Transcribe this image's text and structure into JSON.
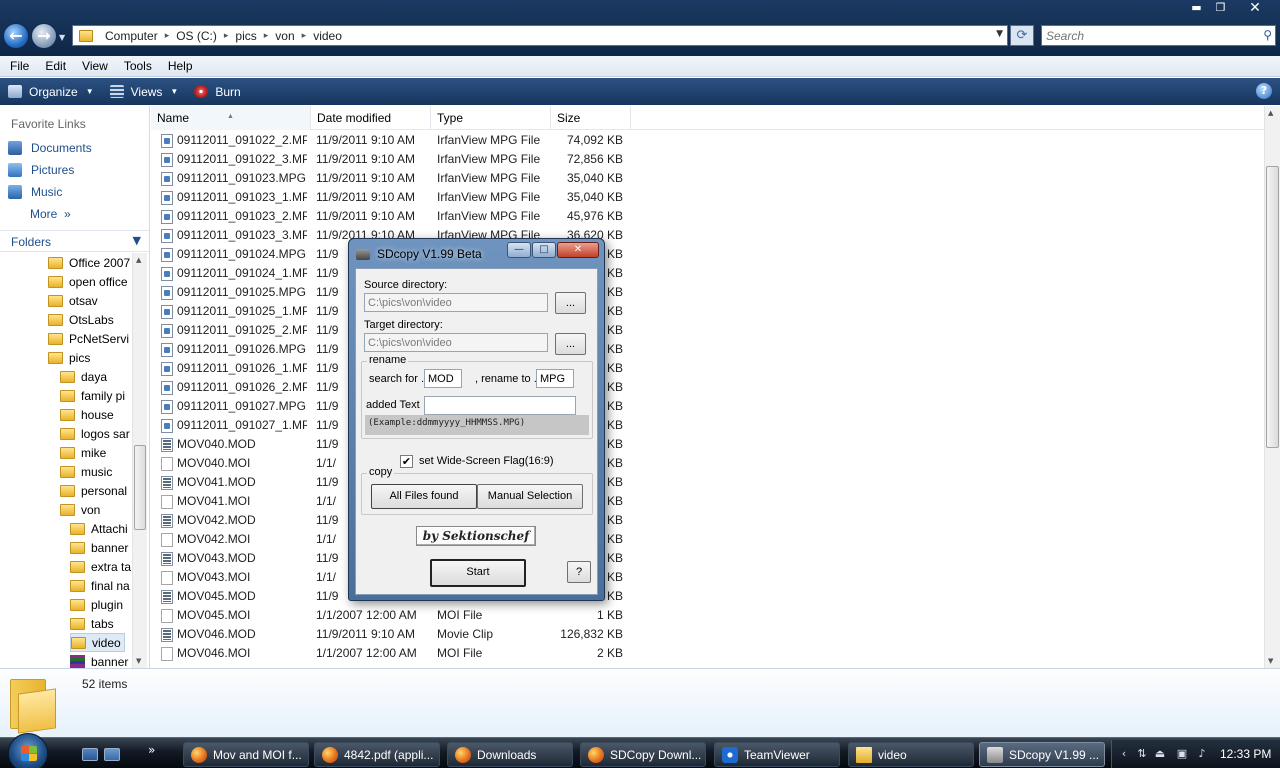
{
  "explorer": {
    "breadcrumbs": [
      "Computer",
      "OS (C:)",
      "pics",
      "von",
      "video"
    ],
    "search_placeholder": "Search",
    "window_controls": {
      "minimize": "▬",
      "maximize": "❐",
      "close": "✕"
    },
    "menu": [
      "File",
      "Edit",
      "View",
      "Tools",
      "Help"
    ],
    "toolbar": {
      "organize": "Organize",
      "views": "Views",
      "burn": "Burn",
      "help": "?"
    },
    "favorites": {
      "header": "Favorite Links",
      "items": [
        "Documents",
        "Pictures",
        "Music"
      ],
      "more": "More",
      "more_glyph": "»"
    },
    "folders": {
      "header": "Folders",
      "tree": [
        {
          "label": "Office 2007",
          "level": 1
        },
        {
          "label": "open office",
          "level": 1
        },
        {
          "label": "otsav",
          "level": 1
        },
        {
          "label": "OtsLabs",
          "level": 1
        },
        {
          "label": "PcNetServi",
          "level": 1
        },
        {
          "label": "pics",
          "level": 1
        },
        {
          "label": "daya",
          "level": 2
        },
        {
          "label": "family pi",
          "level": 2
        },
        {
          "label": "house",
          "level": 2
        },
        {
          "label": "logos sar",
          "level": 2
        },
        {
          "label": "mike",
          "level": 2
        },
        {
          "label": "music",
          "level": 2
        },
        {
          "label": "personal",
          "level": 2
        },
        {
          "label": "von",
          "level": 2
        },
        {
          "label": "Attachi",
          "level": 3
        },
        {
          "label": "banner",
          "level": 3
        },
        {
          "label": "extra ta",
          "level": 3
        },
        {
          "label": "final na",
          "level": 3
        },
        {
          "label": "plugin",
          "level": 3
        },
        {
          "label": "tabs",
          "level": 3
        },
        {
          "label": "video",
          "level": 3,
          "selected": true
        },
        {
          "label": "banner",
          "level": 3,
          "archive": true
        }
      ]
    },
    "columns": {
      "name": "Name",
      "date": "Date modified",
      "type": "Type",
      "size": "Size"
    },
    "files": [
      {
        "name": "09112011_091022_2.MPG",
        "date": "11/9/2011 9:10 AM",
        "type": "IrfanView MPG File",
        "size": "74,092 KB",
        "icon": "mpg"
      },
      {
        "name": "09112011_091022_3.MPG",
        "date": "11/9/2011 9:10 AM",
        "type": "IrfanView MPG File",
        "size": "72,856 KB",
        "icon": "mpg"
      },
      {
        "name": "09112011_091023.MPG",
        "date": "11/9/2011 9:10 AM",
        "type": "IrfanView MPG File",
        "size": "35,040 KB",
        "icon": "mpg"
      },
      {
        "name": "09112011_091023_1.MPG",
        "date": "11/9/2011 9:10 AM",
        "type": "IrfanView MPG File",
        "size": "35,040 KB",
        "icon": "mpg"
      },
      {
        "name": "09112011_091023_2.MPG",
        "date": "11/9/2011 9:10 AM",
        "type": "IrfanView MPG File",
        "size": "45,976 KB",
        "icon": "mpg"
      },
      {
        "name": "09112011_091023_3.MPG",
        "date": "11/9/2011 9:10 AM",
        "type": "IrfanView MPG File",
        "size": "36,620 KB",
        "icon": "mpg"
      },
      {
        "name": "09112011_091024.MPG",
        "date": "11/9",
        "type": "",
        "size": "KB",
        "icon": "mpg"
      },
      {
        "name": "09112011_091024_1.MPG",
        "date": "11/9",
        "type": "",
        "size": "KB",
        "icon": "mpg"
      },
      {
        "name": "09112011_091025.MPG",
        "date": "11/9",
        "type": "",
        "size": "KB",
        "icon": "mpg"
      },
      {
        "name": "09112011_091025_1.MPG",
        "date": "11/9",
        "type": "",
        "size": "KB",
        "icon": "mpg"
      },
      {
        "name": "09112011_091025_2.MPG",
        "date": "11/9",
        "type": "",
        "size": "KB",
        "icon": "mpg"
      },
      {
        "name": "09112011_091026.MPG",
        "date": "11/9",
        "type": "",
        "size": "KB",
        "icon": "mpg"
      },
      {
        "name": "09112011_091026_1.MPG",
        "date": "11/9",
        "type": "",
        "size": "KB",
        "icon": "mpg"
      },
      {
        "name": "09112011_091026_2.MPG",
        "date": "11/9",
        "type": "",
        "size": "KB",
        "icon": "mpg"
      },
      {
        "name": "09112011_091027.MPG",
        "date": "11/9",
        "type": "",
        "size": "KB",
        "icon": "mpg"
      },
      {
        "name": "09112011_091027_1.MPG",
        "date": "11/9",
        "type": "",
        "size": "KB",
        "icon": "mpg"
      },
      {
        "name": "MOV040.MOD",
        "date": "11/9",
        "type": "",
        "size": "KB",
        "icon": "mod"
      },
      {
        "name": "MOV040.MOI",
        "date": "1/1/",
        "type": "",
        "size": "KB",
        "icon": "moi"
      },
      {
        "name": "MOV041.MOD",
        "date": "11/9",
        "type": "",
        "size": "KB",
        "icon": "mod"
      },
      {
        "name": "MOV041.MOI",
        "date": "1/1/",
        "type": "",
        "size": "KB",
        "icon": "moi"
      },
      {
        "name": "MOV042.MOD",
        "date": "11/9",
        "type": "",
        "size": "KB",
        "icon": "mod"
      },
      {
        "name": "MOV042.MOI",
        "date": "1/1/",
        "type": "",
        "size": "KB",
        "icon": "moi"
      },
      {
        "name": "MOV043.MOD",
        "date": "11/9",
        "type": "",
        "size": "KB",
        "icon": "mod"
      },
      {
        "name": "MOV043.MOI",
        "date": "1/1/",
        "type": "",
        "size": "KB",
        "icon": "moi"
      },
      {
        "name": "MOV045.MOD",
        "date": "11/9",
        "type": "",
        "size": "KB",
        "icon": "mod"
      },
      {
        "name": "MOV045.MOI",
        "date": "1/1/2007 12:00 AM",
        "type": "MOI File",
        "size": "1 KB",
        "icon": "moi"
      },
      {
        "name": "MOV046.MOD",
        "date": "11/9/2011 9:10 AM",
        "type": "Movie Clip",
        "size": "126,832 KB",
        "icon": "mod"
      },
      {
        "name": "MOV046.MOI",
        "date": "1/1/2007 12:00 AM",
        "type": "MOI File",
        "size": "2 KB",
        "icon": "moi"
      }
    ],
    "status": {
      "items_count": "52 items"
    }
  },
  "dialog": {
    "title": "SDcopy V1.99 Beta",
    "controls": {
      "minimize": "—",
      "maximize": "□",
      "close": "✕"
    },
    "source_label": "Source directory:",
    "source_value": "C:\\pics\\von\\video",
    "target_label": "Target directory:",
    "target_value": "C:\\pics\\von\\video",
    "browse_label": "...",
    "rename_group": "rename",
    "search_for_label": "search for .",
    "search_for_value": "MOD",
    "rename_to_label": ", rename to .",
    "rename_to_value": "MPG",
    "added_text_label": "added Text",
    "added_text_value": "",
    "example": "(Example:ddmmyyyy_HHMMSS.MPG)",
    "widescreen_label": "set Wide-Screen Flag(16:9)",
    "widescreen_checked": "✔",
    "copy_group": "copy",
    "all_files_button": "All Files found",
    "manual_button": "Manual Selection",
    "byline": "by Sektionschef",
    "start_button": "Start",
    "help_button": "?"
  },
  "taskbar": {
    "ql_more": "»",
    "tasks": [
      {
        "label": "Mov and MOI f...",
        "icon": "ff"
      },
      {
        "label": "4842.pdf (appli...",
        "icon": "ff"
      },
      {
        "label": "Downloads",
        "icon": "ff"
      },
      {
        "label": "SDCopy Downl...",
        "icon": "ff"
      },
      {
        "label": "TeamViewer",
        "icon": "tv"
      },
      {
        "label": "video",
        "icon": "fld"
      },
      {
        "label": "SDcopy V1.99 ...",
        "icon": "sd",
        "active": true
      }
    ],
    "tray_chevron": "‹",
    "clock": "12:33 PM"
  }
}
